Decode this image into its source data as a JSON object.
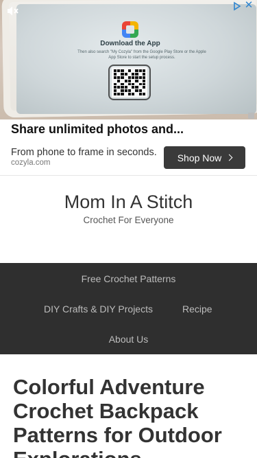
{
  "ad": {
    "image": {
      "title": "Download the App",
      "subtitle": "Then also search \"My Cozyla\" from the Google Play Store or the Apple App Store to start the setup process."
    },
    "headline": "Share unlimited photos and...",
    "body": "From phone to frame in seconds.",
    "domain": "cozyla.com",
    "cta_label": "Shop Now",
    "cta_color": "#3a3a3a",
    "close_color": "#2e84cf"
  },
  "site": {
    "title": "Mom In A Stitch",
    "tagline": "Crochet For Everyone"
  },
  "nav": {
    "background": "#2f2f2f",
    "items": [
      {
        "label": "Free Crochet Patterns"
      },
      {
        "label": "DIY Crafts & DIY Projects"
      },
      {
        "label": "Recipe"
      },
      {
        "label": "About Us"
      }
    ]
  },
  "article": {
    "title": "Colorful Adventure Crochet Backpack Patterns for Outdoor Explorations"
  }
}
